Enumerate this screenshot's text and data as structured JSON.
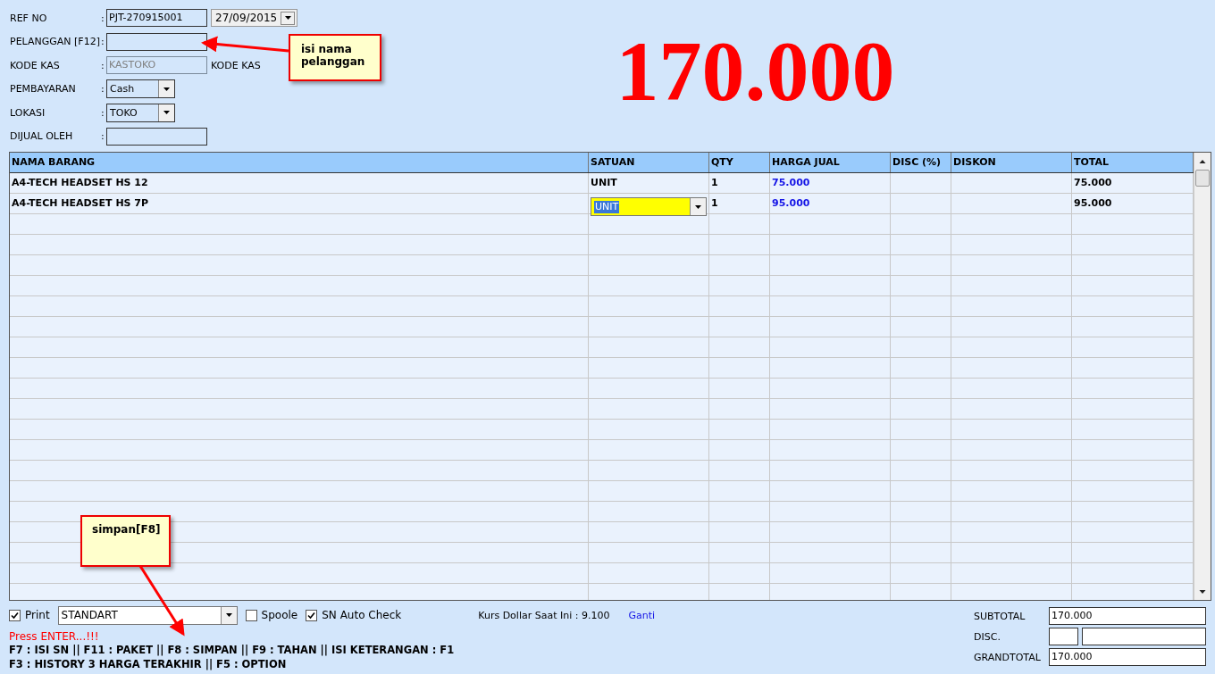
{
  "form": {
    "fields": [
      {
        "label": "REF NO",
        "colon": ":",
        "kind": "text",
        "value": "PJT-270915001",
        "disabled": false,
        "date": "27/09/2015"
      },
      {
        "label": "PELANGGAN [F12]",
        "colon": ":",
        "kind": "text",
        "disabled": false
      },
      {
        "label": "KODE KAS",
        "colon": ":",
        "kind": "text",
        "value": "KASTOKO",
        "disabled": true,
        "suffix": "KODE KAS"
      },
      {
        "label": "PEMBAYARAN",
        "colon": ":",
        "kind": "combo",
        "value": "Cash",
        "disabled": false
      },
      {
        "label": "LOKASI",
        "colon": ":",
        "kind": "combo",
        "value": "TOKO",
        "disabled": false
      },
      {
        "label": "DIJUAL OLEH",
        "colon": ":",
        "kind": "text",
        "disabled": false
      }
    ]
  },
  "total_display": "170.000",
  "grid": {
    "columns": [
      "NAMA BARANG",
      "SATUAN",
      "QTY",
      "HARGA JUAL",
      "DISC (%)",
      "DISKON",
      "TOTAL"
    ],
    "rows": [
      {
        "nama": "A4-TECH HEADSET HS 12",
        "satuan": {
          "text": "UNIT",
          "editing": false
        },
        "qty": "1",
        "harga": "75.000",
        "total": "75.000"
      },
      {
        "nama": "A4-TECH HEADSET HS 7P",
        "satuan": {
          "text": "UNIT",
          "editing": true
        },
        "qty": "1",
        "harga": "95.000",
        "total": "95.000"
      }
    ]
  },
  "bottom": {
    "options": [
      {
        "kind": "checkbox",
        "label": "Print",
        "checked": true
      },
      {
        "kind": "select",
        "value": "STANDART"
      },
      {
        "kind": "checkbox",
        "label": "Spoole",
        "checked": false
      },
      {
        "kind": "checkbox",
        "label": "SN Auto Check",
        "checked": true
      }
    ],
    "kurs": "Kurs Dollar Saat Ini : 9.100",
    "ganti": "Ganti",
    "status": "Press ENTER...!!!",
    "hints": [
      "F7 : ISI SN || F11 : PAKET || F8 : SIMPAN || F9 : TAHAN || ISI KETERANGAN : F1",
      "F3 : HISTORY 3 HARGA TERAKHIR || F5 : OPTION"
    ],
    "totals": {
      "subtotal_label": "SUBTOTAL",
      "subtotal": "170.000",
      "disc_label": "DISC.",
      "grandtotal_label": "GRANDTOTAL",
      "grandtotal": "170.000"
    }
  },
  "callouts": [
    {
      "text": "isi nama pelanggan"
    },
    {
      "text": "simpan[F8]"
    }
  ]
}
